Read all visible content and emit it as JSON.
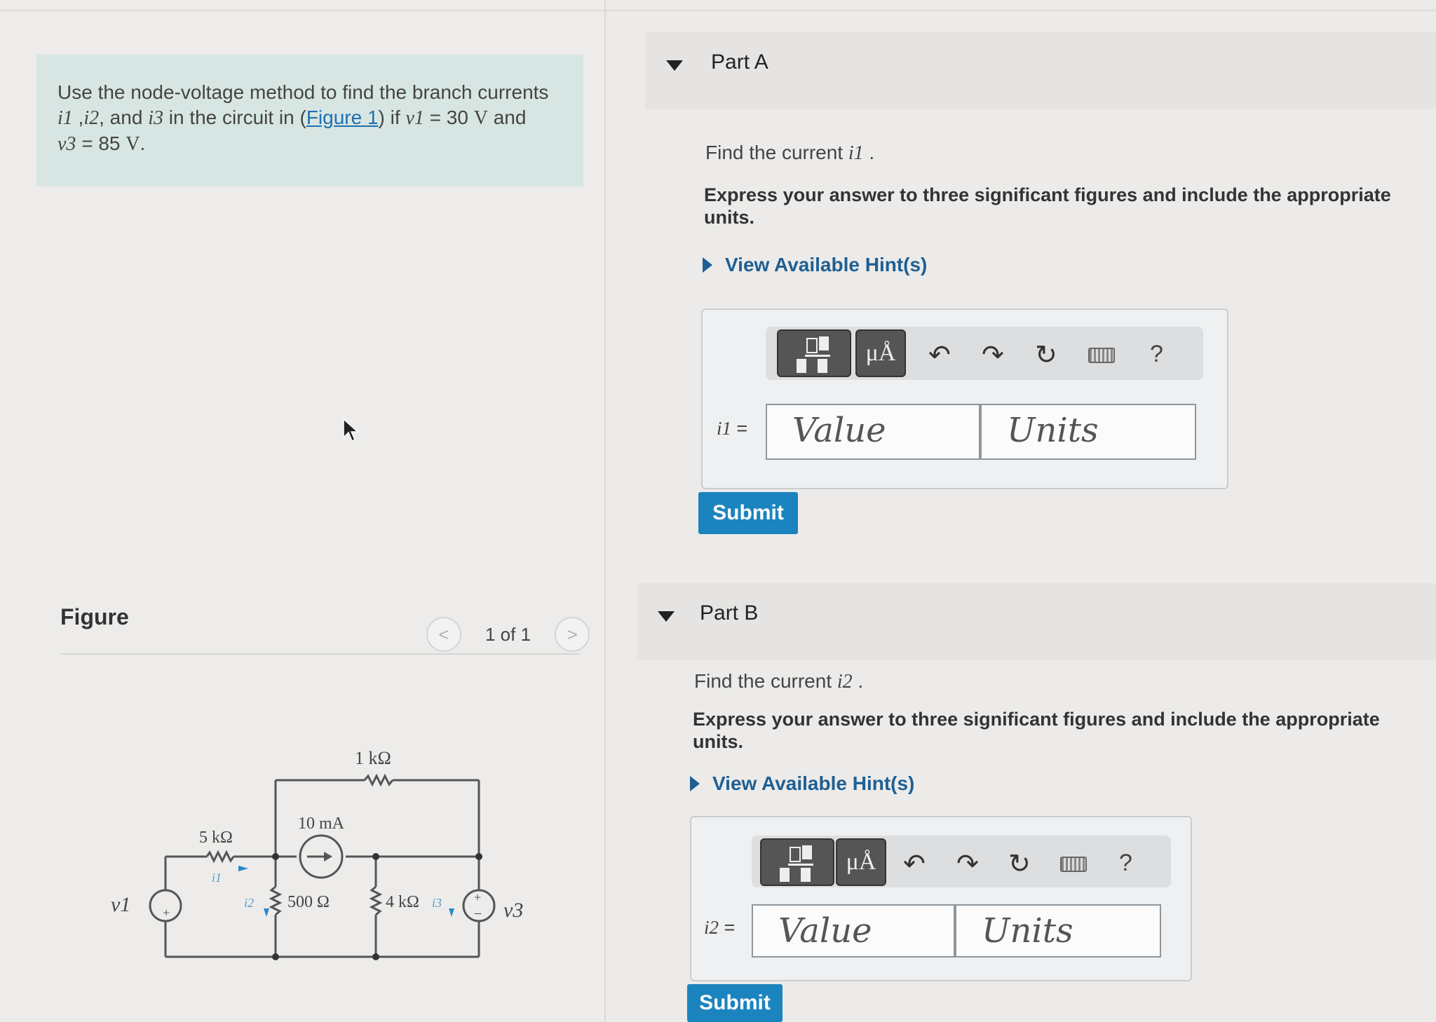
{
  "problem": {
    "line1": "Use the node-voltage method to find the branch currents",
    "i1": "i1",
    "sep1": " ,",
    "i2": "i2",
    "and": ", and ",
    "i3": "i3",
    "mid": " in the circuit in (",
    "figure_link": "Figure 1",
    "if": ") if ",
    "v1": "v1",
    "v1_val": " = 30 ",
    "V1unit": "V",
    "and2": " and",
    "v3": "v3",
    "v3_val": " = 85 ",
    "V3unit": "V",
    "end": "."
  },
  "figure": {
    "title": "Figure",
    "pager": "1 of 1",
    "prev": "<",
    "next": ">",
    "circuit": {
      "r_top": "1 kΩ",
      "r_left": "5 kΩ",
      "source_current": "10 mA",
      "r_mid": "500 Ω",
      "r_right": "4 kΩ",
      "v1_label": "v1",
      "v3_label": "v3",
      "i1_label": "i1",
      "i2_label": "i2",
      "i3_label": "i3",
      "plus": "+",
      "minus": "−"
    }
  },
  "partA": {
    "title": "Part A",
    "question_pre": "Find the current ",
    "question_var": "i1",
    "question_post": " .",
    "instructions": "Express your answer to three significant figures and include the appropriate units.",
    "hint": "View Available Hint(s)",
    "label_var": "i1",
    "label_eq": " =",
    "value_placeholder": "Value",
    "units_placeholder": "Units",
    "submit": "Submit"
  },
  "partB": {
    "title": "Part B",
    "question_pre": "Find the current ",
    "question_var": "i2",
    "question_post": " .",
    "instructions": "Express your answer to three significant figures and include the appropriate units.",
    "hint": "View Available Hint(s)",
    "label_var": "i2",
    "label_eq": " =",
    "value_placeholder": "Value",
    "units_placeholder": "Units",
    "submit": "Submit"
  },
  "toolbar": {
    "units_glyph": "μÅ",
    "undo": "↶",
    "redo": "↷",
    "reset": "↻",
    "help": "?"
  }
}
